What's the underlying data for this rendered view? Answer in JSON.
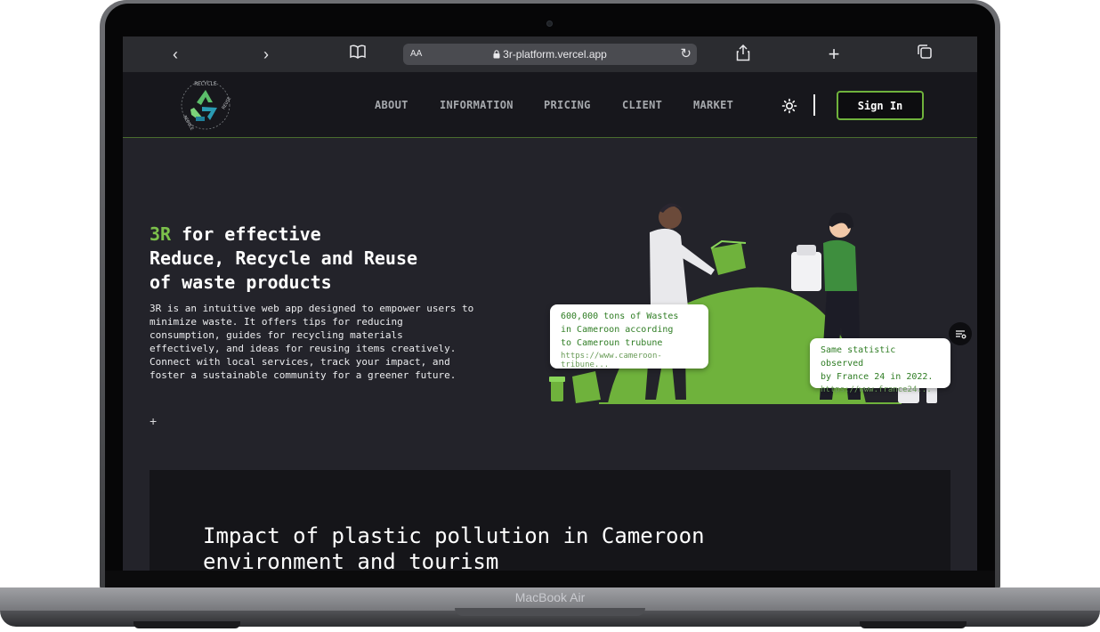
{
  "device": {
    "label": "MacBook Air"
  },
  "browser": {
    "url": "3r-platform.vercel.app",
    "aa_label": "AA"
  },
  "nav": {
    "links": [
      "ABOUT",
      "INFORMATION",
      "PRICING",
      "CLIENT",
      "MARKET"
    ],
    "sign_in": "Sign In"
  },
  "logo": {
    "top_text": "RECYCLE",
    "left_text": "REDUCE",
    "right_text": "REUSE"
  },
  "hero": {
    "title_accent": "3R",
    "title_line1": " for effective",
    "title_line2": "Reduce, Recycle and Reuse",
    "title_line3": "of waste products",
    "description": "3R is an intuitive web app designed to empower users to minimize waste. It offers tips for reducing consumption, guides for recycling materials effectively, and ideas for reusing items creatively. Connect with local services, track your impact, and foster a sustainable community for a greener future.",
    "plus": "+"
  },
  "stats": [
    {
      "text": "600,000 tons of Wastes\nin Cameroon according\nto Cameroun trubune",
      "url": "https://www.cameroon-tribune..."
    },
    {
      "text": "Same statistic observed\nby France 24 in 2022.",
      "url": "https://www.france24..."
    }
  ],
  "section": {
    "title": "Impact of plastic pollution in Cameroon environment and tourism"
  },
  "colors": {
    "accent": "#7cc04b",
    "background": "#23232a",
    "nav": "#17171c"
  }
}
